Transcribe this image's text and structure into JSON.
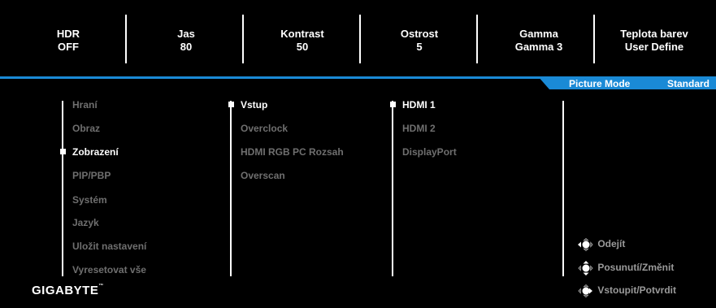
{
  "status_bar": [
    {
      "label": "HDR",
      "value": "OFF"
    },
    {
      "label": "Jas",
      "value": "80"
    },
    {
      "label": "Kontrast",
      "value": "50"
    },
    {
      "label": "Ostrost",
      "value": "5"
    },
    {
      "label": "Gamma",
      "value": "Gamma 3"
    },
    {
      "label": "Teplota barev",
      "value": "User Define"
    }
  ],
  "picture_mode": {
    "label": "Picture Mode",
    "value": "Standard"
  },
  "main_menu": [
    "Hraní",
    "Obraz",
    "Zobrazení",
    "PIP/PBP",
    "Systém",
    "Jazyk",
    "Uložit nastavení",
    "Vyresetovat vše"
  ],
  "sub_menu": [
    "Vstup",
    "Overclock",
    "HDMI RGB PC Rozsah",
    "Overscan"
  ],
  "input_menu": [
    "HDMI 1",
    "HDMI 2",
    "DisplayPort"
  ],
  "brand": "GIGABYTE",
  "brand_tm": "™",
  "help": [
    {
      "icon": "joystick-left-icon",
      "text": "Odejít"
    },
    {
      "icon": "joystick-updown-icon",
      "text": "Posunutí/Změnit"
    },
    {
      "icon": "joystick-press-icon",
      "text": "Vstoupit/Potvrdit"
    }
  ],
  "colors": {
    "accent": "#1a8ad6",
    "background": "#000000",
    "active_text": "#ffffff",
    "inactive_text": "#6f6f6f"
  }
}
